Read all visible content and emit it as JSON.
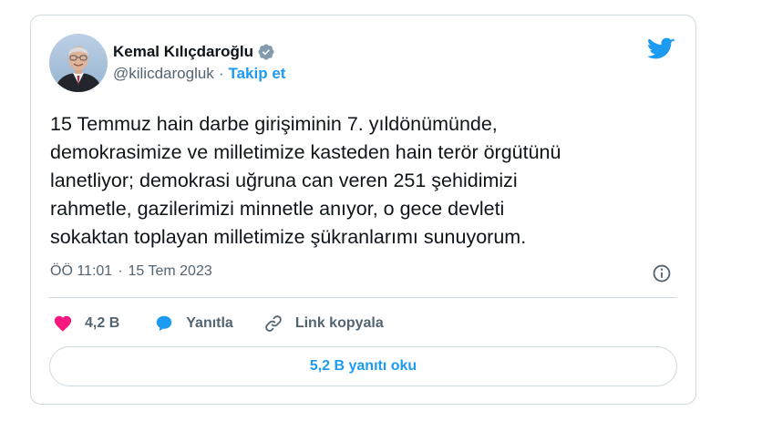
{
  "author": {
    "display_name": "Kemal Kılıçdaroğlu",
    "handle": "@kilicdarogluk",
    "separator": "·",
    "follow_label": "Takip et"
  },
  "tweet": {
    "text": "15 Temmuz hain darbe girişiminin 7. yıldönümünde,\ndemokrasimize ve milletimize kasteden hain terör örgütünü\nlanetliyor; demokrasi uğruna can veren 251 şehidimizi\nrahmetle, gazilerimizi minnetle anıyor, o gece devleti\nsokaktan toplayan milletimize şükranlarımı sunuyorum.",
    "time": "ÖÖ 11:01",
    "separator": "·",
    "date": "15 Tem 2023"
  },
  "actions": {
    "like_count": "4,2 B",
    "reply_label": "Yanıtla",
    "copy_link_label": "Link kopyala"
  },
  "read_replies_label": "5,2 B yanıtı oku",
  "icons": {
    "verified": "verified-badge-icon",
    "platform": "twitter-bird-icon",
    "info": "info-icon",
    "like": "heart-icon",
    "reply": "speech-bubble-icon",
    "link": "link-icon"
  },
  "colors": {
    "accent": "#1d9bf0",
    "like": "#f91880",
    "text": "#0f1419",
    "secondary": "#536471",
    "border": "#cfd9de"
  }
}
